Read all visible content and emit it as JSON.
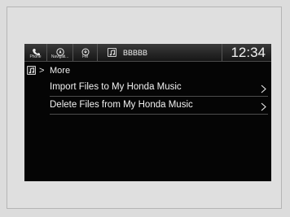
{
  "statusbar": {
    "phone_label": "Phone",
    "navigation_label": "Navigati...",
    "fm_label": "FM",
    "source_name": "BBBBB",
    "clock": "12:34"
  },
  "breadcrumb": {
    "label": "More"
  },
  "menu": {
    "items": [
      {
        "label": "Import Files to My Honda Music"
      },
      {
        "label": "Delete Files from My Honda Music"
      }
    ]
  }
}
